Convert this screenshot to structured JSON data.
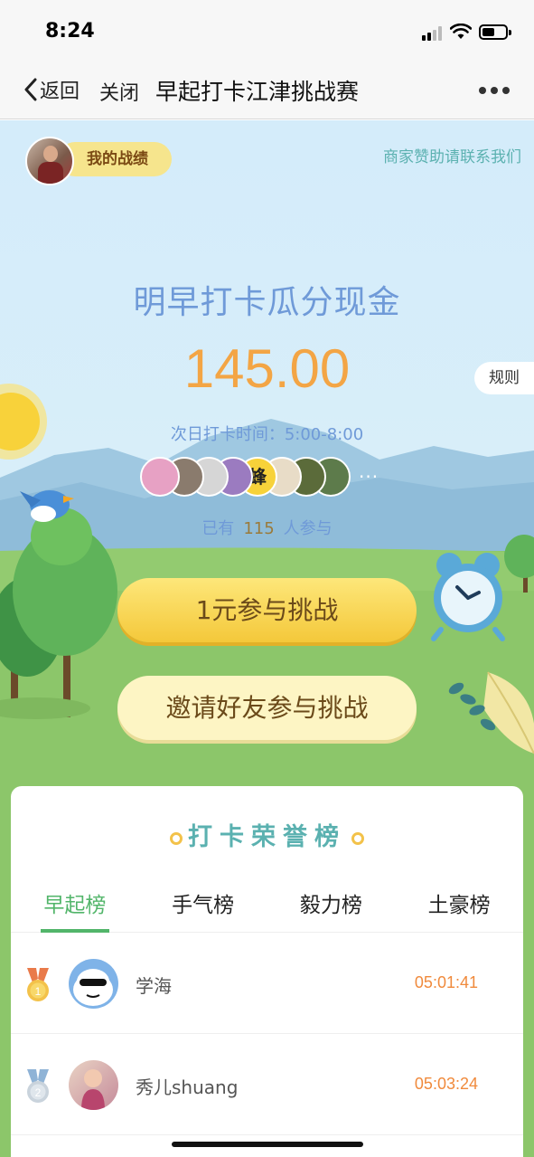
{
  "status_bar": {
    "time": "8:24"
  },
  "nav": {
    "back_label": "返回",
    "close_label": "关闭",
    "title": "早起打卡江津挑战赛"
  },
  "hero": {
    "my_record_label": "我的战绩",
    "sponsor_link": "商家赞助请联系我们",
    "headline": "明早打卡瓜分现金",
    "amount": "145.00",
    "rules_label": "规则",
    "checkin_time": "次日打卡时间：5:00-8:00",
    "participant_prefix": "已有",
    "participant_count": "115",
    "participant_suffix": "人参与",
    "participant_avatars": [
      {
        "icon": "pink-flower-avatar",
        "color": "#e7a1c4"
      },
      {
        "icon": "kettle-avatar",
        "color": "#8a7b6d"
      },
      {
        "icon": "keyboard-avatar",
        "color": "#d6d6d6"
      },
      {
        "icon": "purple-flower-avatar",
        "color": "#9b7bc0"
      },
      {
        "icon": "bee-avatar",
        "color": "#f7d23a",
        "text": "蜂"
      },
      {
        "icon": "cat-avatar",
        "color": "#e8dcc7"
      },
      {
        "icon": "plant-avatar",
        "color": "#5b6b3a"
      },
      {
        "icon": "forest-avatar",
        "color": "#5d7b4b"
      }
    ],
    "more_label": "···",
    "join_button": "1元参与挑战",
    "invite_button": "邀请好友参与挑战"
  },
  "board": {
    "title": "打卡荣誉榜",
    "tabs": [
      {
        "label": "早起榜",
        "active": true
      },
      {
        "label": "手气榜",
        "active": false
      },
      {
        "label": "毅力榜",
        "active": false
      },
      {
        "label": "土豪榜",
        "active": false
      }
    ],
    "rows": [
      {
        "rank": "1",
        "name": "学海",
        "time": "05:01:41",
        "medal_color": "#f3c24a",
        "ribbon_color": "#e97a4a"
      },
      {
        "rank": "2",
        "name": "秀儿shuang",
        "time": "05:03:24",
        "medal_color": "#c9d3dc",
        "ribbon_color": "#8fb3d6"
      }
    ]
  },
  "colors": {
    "accent_green": "#52b56a",
    "title_blue": "#6f9ad8",
    "amount_orange": "#f3a545",
    "time_orange": "#f08a3c",
    "board_teal": "#5bb1b0"
  }
}
